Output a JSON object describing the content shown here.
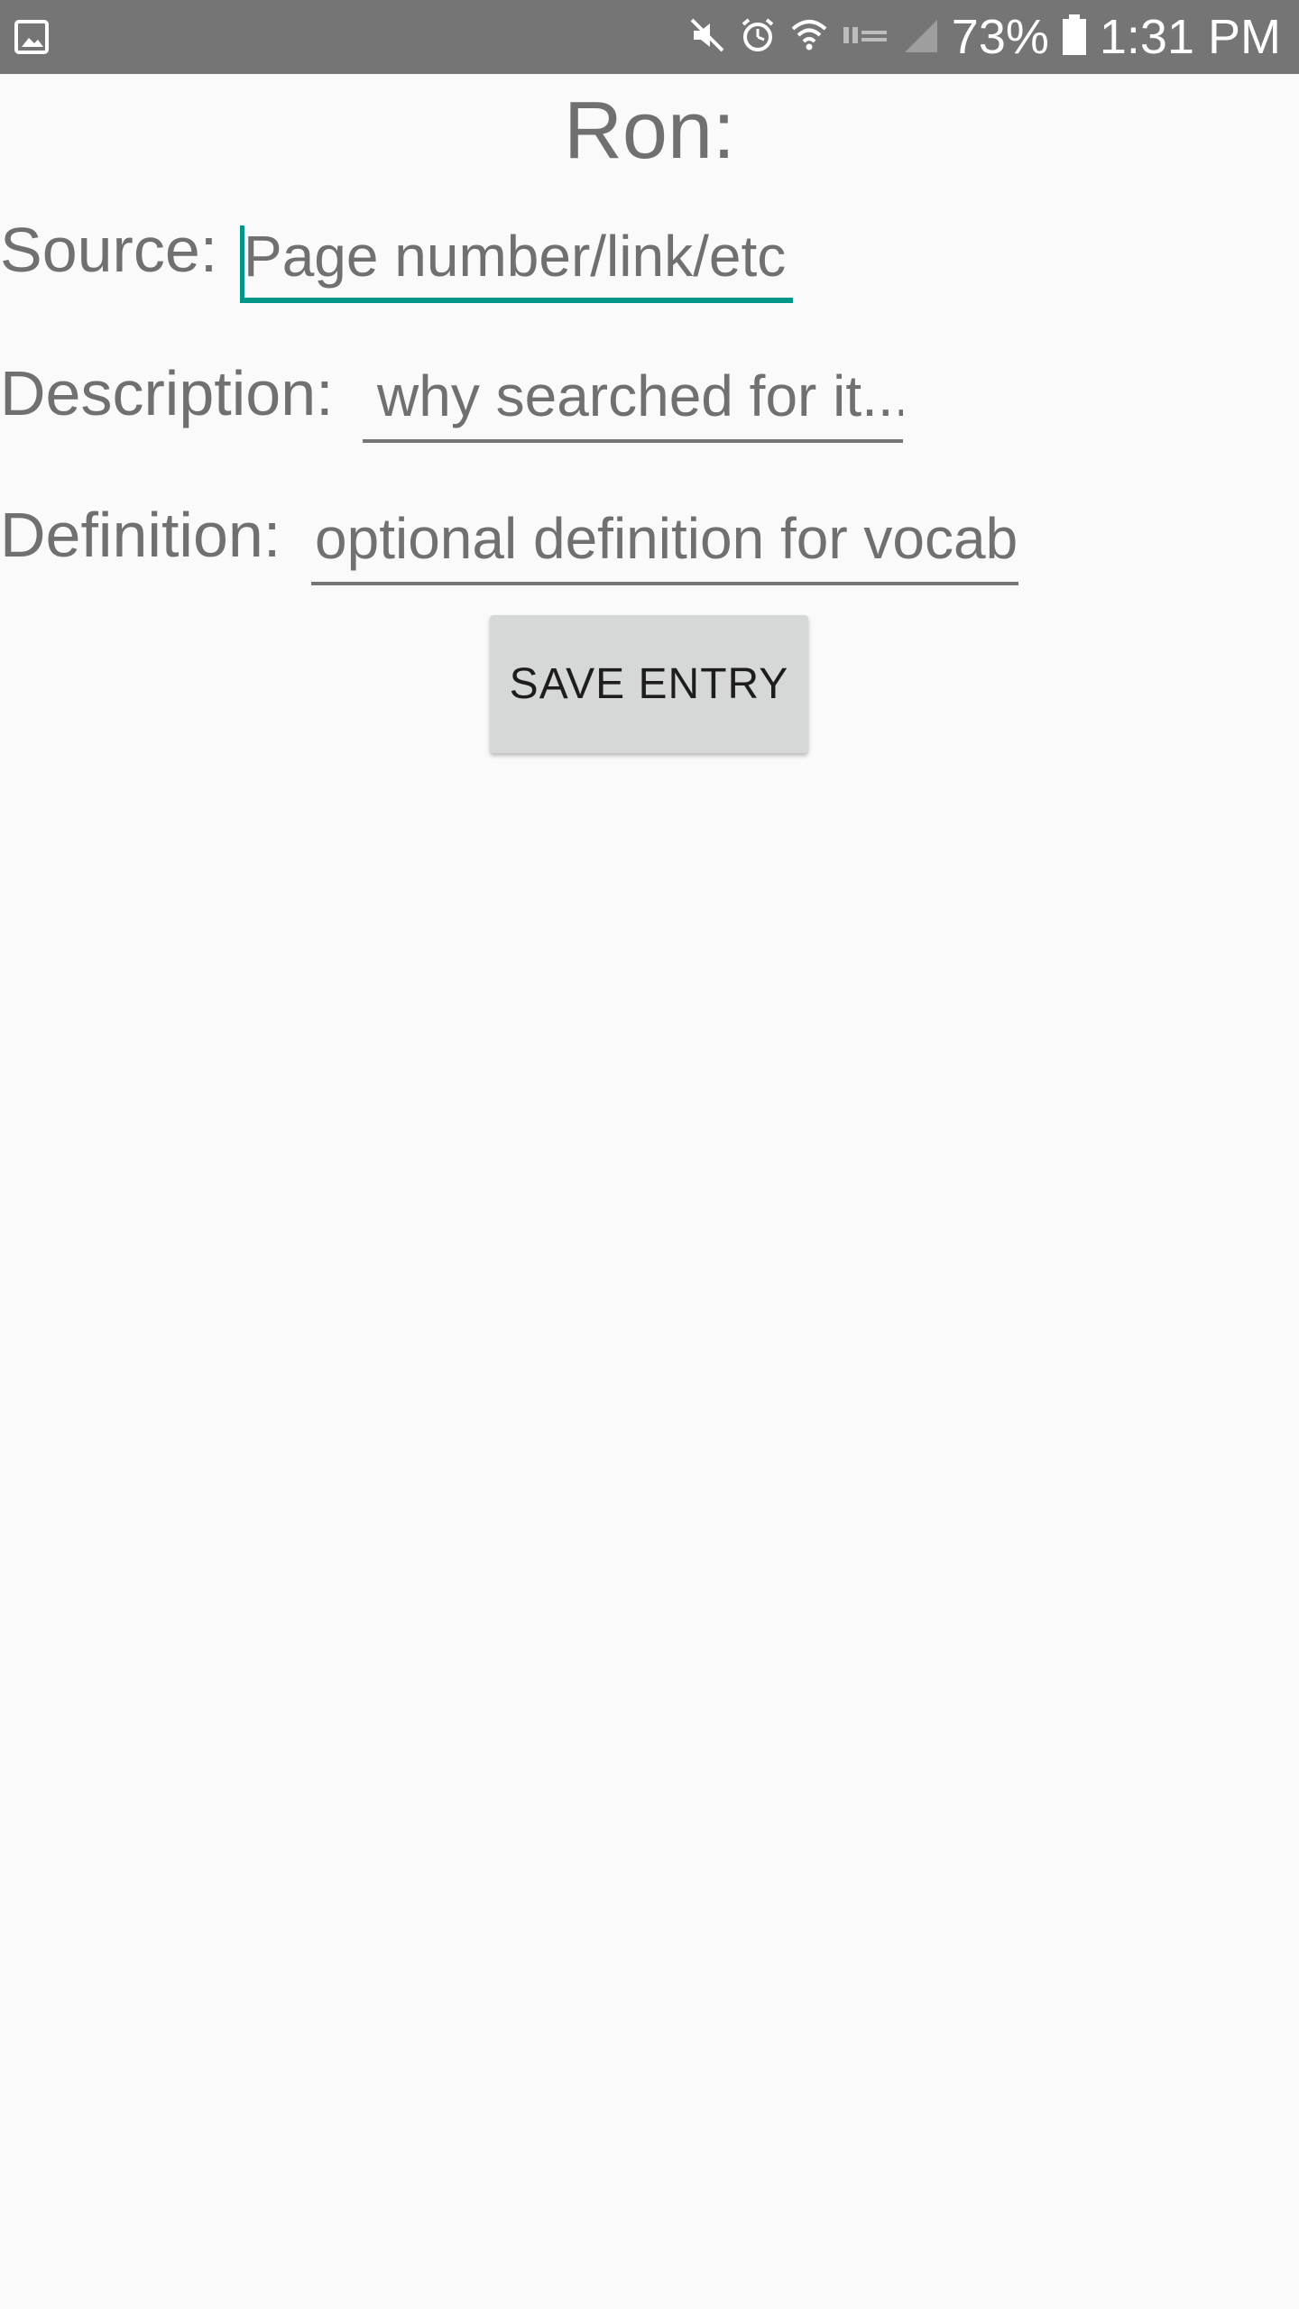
{
  "status_bar": {
    "battery_percent": "73%",
    "time": "1:31 PM",
    "icons": [
      "gallery-icon",
      "mute-icon",
      "alarm-icon",
      "wifi-icon",
      "lte-icon",
      "signal-icon",
      "battery-icon"
    ],
    "background_color": "#757575"
  },
  "form": {
    "title": "Ron:",
    "source": {
      "label": "Source:",
      "placeholder": "Page number/link/etc",
      "value": ""
    },
    "description": {
      "label": "Description:",
      "placeholder": "why searched for it...",
      "value": ""
    },
    "definition": {
      "label": "Definition:",
      "placeholder": "optional definition for vocab",
      "value": ""
    },
    "save_label": "SAVE ENTRY"
  },
  "colors": {
    "accent": "#009688",
    "text": "#707070",
    "button_bg": "#d6d7d7",
    "background": "#fafafa"
  }
}
